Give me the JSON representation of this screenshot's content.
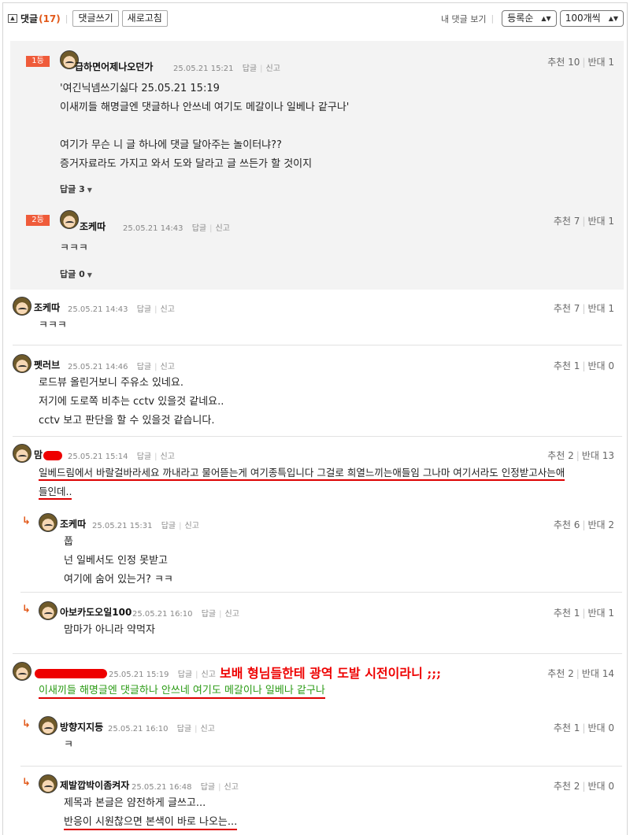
{
  "toolbar": {
    "title": "댓글",
    "count": "(17)",
    "write_label": "댓글쓰기",
    "refresh_label": "새로고침",
    "my_comments": "내 댓글 보기",
    "sort_value": "등록순",
    "per_page_value": "100개씩"
  },
  "labels": {
    "reply": "답글",
    "report": "신고",
    "up": "추천",
    "down": "반대"
  },
  "best": [
    {
      "rank": "1등",
      "nick": "급하면어제나오던가",
      "time": "25.05.21 15:21",
      "up": "10",
      "down": "1",
      "lines": [
        "'여긴닉넴쓰기싫다 25.05.21 15:19",
        "이새끼들 해명글엔 댓글하나 안쓰네 여기도 메갈이나 일베나 같구나'",
        "",
        "여기가 무슨 니 글 하나에 댓글 달아주는 놀이터냐??",
        "증거자료라도 가지고 와서 도와 달라고 글 쓰든가 할 것이지"
      ],
      "reply_count": "답글 3"
    },
    {
      "rank": "2등",
      "nick": "조케따",
      "time": "25.05.21 14:43",
      "up": "7",
      "down": "1",
      "lines": [
        "ㅋㅋㅋ"
      ],
      "reply_count": "답글 0"
    }
  ],
  "comments": [
    {
      "nick": "조케따",
      "time": "25.05.21 14:43",
      "up": "7",
      "down": "1",
      "lines": [
        "ㅋㅋㅋ"
      ]
    },
    {
      "nick": "펫러브",
      "time": "25.05.21 14:46",
      "up": "1",
      "down": "0",
      "lines": [
        "로드뷰 올린거보니 주유소 있네요.",
        "저기에 도로쪽 비추는 cctv 있을것 같네요..",
        "cctv 보고 판단을 할 수 있을것 같습니다."
      ]
    },
    {
      "nick": "맘",
      "time": "25.05.21 15:14",
      "up": "2",
      "down": "13",
      "lines": [
        "일베드림에서 바랄걸바라세요 까내라고 물어뜯는게 여기종특입니다 그걸로 희열느끼는애들임 그나마 여기서라도 인정받고사는애",
        "들인데.."
      ]
    },
    {
      "nick": "조케따",
      "time": "25.05.21 15:31",
      "up": "6",
      "down": "2",
      "lines": [
        "풉",
        "넌 일베서도 인정 못받고",
        "여기에 숨어 있는거? ㅋㅋ"
      ]
    },
    {
      "nick": "아보카도오일100",
      "time": "25.05.21 16:10",
      "up": "1",
      "down": "1",
      "lines": [
        "맘마가 아니라 약먹자"
      ]
    },
    {
      "nick": "",
      "time": "25.05.21 15:19",
      "up": "2",
      "down": "14",
      "lines": [
        "이새끼들 해명글엔 댓글하나 안쓰네 여기도 메갈이나 일베나 같구나"
      ],
      "annotation": "보배 형님들한테 광역 도발 시전이라니 ;;;"
    },
    {
      "nick": "방향지지등",
      "time": "25.05.21 16:10",
      "up": "1",
      "down": "0",
      "lines": [
        "ㅋ"
      ]
    },
    {
      "nick": "제발깝박이좀켜자",
      "time": "25.05.21 16:48",
      "up": "2",
      "down": "0",
      "lines": [
        "제목과 본글은 얌전하게 글쓰고...",
        "반응이 시원찮으면 본색이 바로 나오는..."
      ]
    }
  ],
  "colors": {
    "accent": "#e2591a",
    "rank_bg": "#ef5b3a",
    "best_bg": "#f3f3f3",
    "markup_red": "#dd0000",
    "quote_green": "#2b9b15"
  }
}
